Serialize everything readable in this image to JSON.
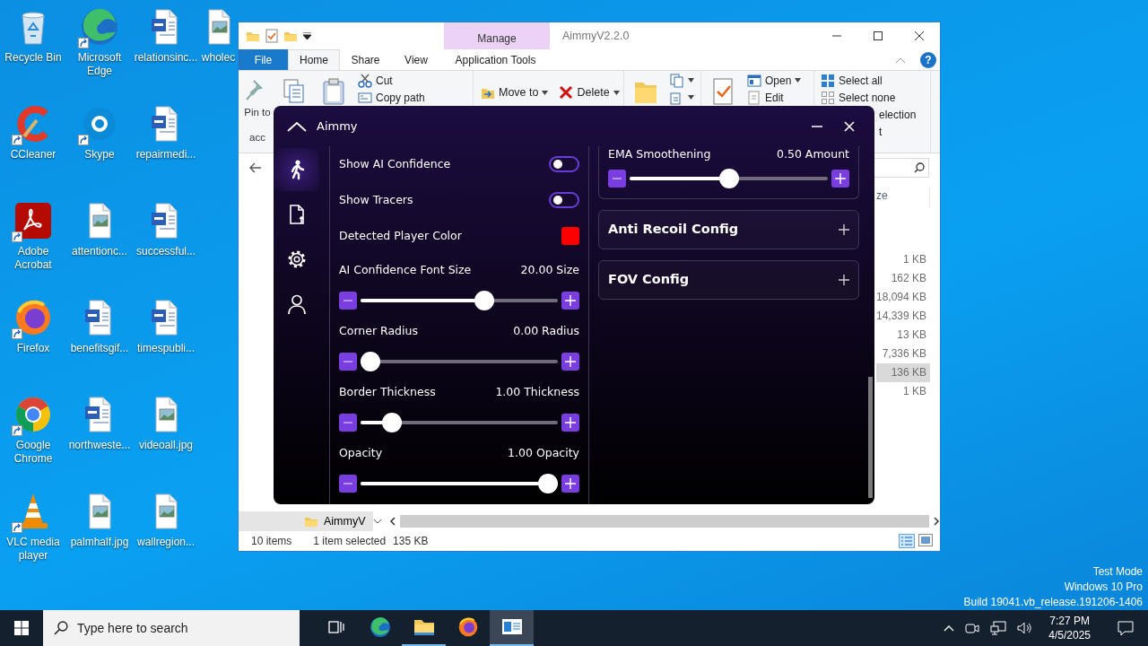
{
  "desktop_icons": [
    {
      "label": "Recycle Bin",
      "kind": "recycle",
      "shortcut": false
    },
    {
      "label": "CCleaner",
      "kind": "ccleaner",
      "shortcut": true
    },
    {
      "label": "Adobe Acrobat",
      "kind": "pdf",
      "shortcut": true
    },
    {
      "label": "Firefox",
      "kind": "firefox",
      "shortcut": true
    },
    {
      "label": "Google Chrome",
      "kind": "chrome",
      "shortcut": true
    },
    {
      "label": "VLC media player",
      "kind": "vlc",
      "shortcut": true
    },
    {
      "label": "Microsoft Edge",
      "kind": "edge",
      "shortcut": true
    },
    {
      "label": "Skype",
      "kind": "skype",
      "shortcut": true
    },
    {
      "label": "attentionc...",
      "kind": "image",
      "shortcut": false
    },
    {
      "label": "benefitsgif...",
      "kind": "word",
      "shortcut": false
    },
    {
      "label": "northweste...",
      "kind": "word",
      "shortcut": false
    },
    {
      "label": "palmhalf.jpg",
      "kind": "image",
      "shortcut": false
    },
    {
      "label": "relationsinc...",
      "kind": "word",
      "shortcut": false
    },
    {
      "label": "repairmedi...",
      "kind": "word",
      "shortcut": false
    },
    {
      "label": "successful...",
      "kind": "word",
      "shortcut": false
    },
    {
      "label": "timespubli...",
      "kind": "word",
      "shortcut": false
    },
    {
      "label": "videoall.jpg",
      "kind": "image",
      "shortcut": false
    },
    {
      "label": "wallregion...",
      "kind": "image",
      "shortcut": false
    },
    {
      "label": "wholec",
      "kind": "image",
      "shortcut": false
    }
  ],
  "explorer": {
    "title": "AimmyV2.2.0",
    "context_group": "Manage",
    "help_label": "?",
    "tabs": [
      {
        "label": "File",
        "kind": "file",
        "selected": false
      },
      {
        "label": "Home",
        "kind": "tab",
        "selected": true
      },
      {
        "label": "Share",
        "kind": "tab",
        "selected": false
      },
      {
        "label": "View",
        "kind": "tab",
        "selected": false
      },
      {
        "label": "Application Tools",
        "kind": "tab",
        "selected": false
      }
    ],
    "ribbon": [
      {
        "buttons": [
          {
            "kind": "pin",
            "lines": [
              "Pin to",
              "acc"
            ],
            "dropdown": false
          },
          {
            "kind": "copy",
            "dropdown": false
          },
          {
            "kind": "paste",
            "dropdown": false
          },
          {
            "kind": "cut",
            "label": "Cut",
            "dropdown": false
          },
          {
            "kind": "copy-path",
            "label": "Copy path",
            "dropdown": false
          }
        ]
      },
      {
        "buttons": [
          {
            "kind": "move",
            "label": "Move to",
            "dropdown": true
          },
          {
            "kind": "delete",
            "label": "Delete",
            "dropdown": true
          }
        ]
      },
      {
        "buttons": [
          {
            "kind": "new-folder",
            "dropdown": false
          },
          {
            "kind": "copy-to",
            "dropdown": true
          },
          {
            "kind": "rename",
            "dropdown": true
          }
        ]
      },
      {
        "buttons": [
          {
            "kind": "properties",
            "dropdown": false
          },
          {
            "kind": "open",
            "label": "Open",
            "dropdown": true
          },
          {
            "kind": "edit",
            "label": "Edit",
            "dropdown": false
          }
        ]
      },
      {
        "buttons": [
          {
            "kind": "select-all",
            "label": "Select all",
            "dropdown": false
          },
          {
            "kind": "select-none",
            "label": "Select none",
            "dropdown": false
          },
          {
            "kind": "text",
            "label": "election",
            "dropdown": false
          },
          {
            "kind": "text",
            "label": "t",
            "dropdown": false
          }
        ]
      }
    ],
    "column_header": "ze",
    "file_sizes": [
      {
        "text": "1 KB",
        "selected": false
      },
      {
        "text": "162 KB",
        "selected": false
      },
      {
        "text": "18,094 KB",
        "selected": false
      },
      {
        "text": "14,339 KB",
        "selected": false
      },
      {
        "text": "13 KB",
        "selected": false
      },
      {
        "text": "7,336 KB",
        "selected": false
      },
      {
        "text": "136 KB",
        "selected": true
      },
      {
        "text": "1 KB",
        "selected": false
      }
    ],
    "nav_item": "AimmyV",
    "status": {
      "count": "10 items",
      "selection": "1 item selected",
      "size": "135 KB"
    }
  },
  "aimmy": {
    "title": "Aimmy",
    "nav": [
      {
        "kind": "aim",
        "selected": true
      },
      {
        "kind": "file",
        "selected": false
      },
      {
        "kind": "settings",
        "selected": false
      },
      {
        "kind": "account",
        "selected": false
      }
    ],
    "left_settings": [
      {
        "kind": "toggle",
        "label": "Show AI Confidence",
        "on": false
      },
      {
        "kind": "toggle",
        "label": "Show Tracers",
        "on": false
      },
      {
        "kind": "color",
        "label": "Detected Player Color",
        "color": "#ff0000"
      },
      {
        "kind": "slider",
        "label": "AI Confidence Font Size",
        "reading": "20.00 Size",
        "level": 0.64
      },
      {
        "kind": "slider",
        "label": "Corner Radius",
        "reading": "0.00 Radius",
        "level": 0
      },
      {
        "kind": "slider",
        "label": "Border Thickness",
        "reading": "1.00 Thickness",
        "level": 0.12
      },
      {
        "kind": "slider",
        "label": "Opacity",
        "reading": "1.00 Opacity",
        "level": 1
      }
    ],
    "ema": {
      "label": "EMA Smoothening",
      "reading": "0.50 Amount",
      "level": 0.5
    },
    "sections": [
      {
        "title": "Anti Recoil Config",
        "expanded": false
      },
      {
        "title": "FOV Config",
        "expanded": false
      }
    ]
  },
  "system_text": [
    "Test Mode",
    "Windows 10 Pro",
    "Build 19041.vb_release.191206-1406"
  ],
  "taskbar": {
    "search_placeholder": "Type here to search",
    "apps": [
      {
        "kind": "edge",
        "running": false,
        "selected": false
      },
      {
        "kind": "folder",
        "running": true,
        "selected": false
      },
      {
        "kind": "firefox",
        "running": false,
        "selected": false
      },
      {
        "kind": "app-window",
        "running": true,
        "selected": true
      }
    ],
    "time": "7:27 PM",
    "date": "4/5/2025"
  }
}
